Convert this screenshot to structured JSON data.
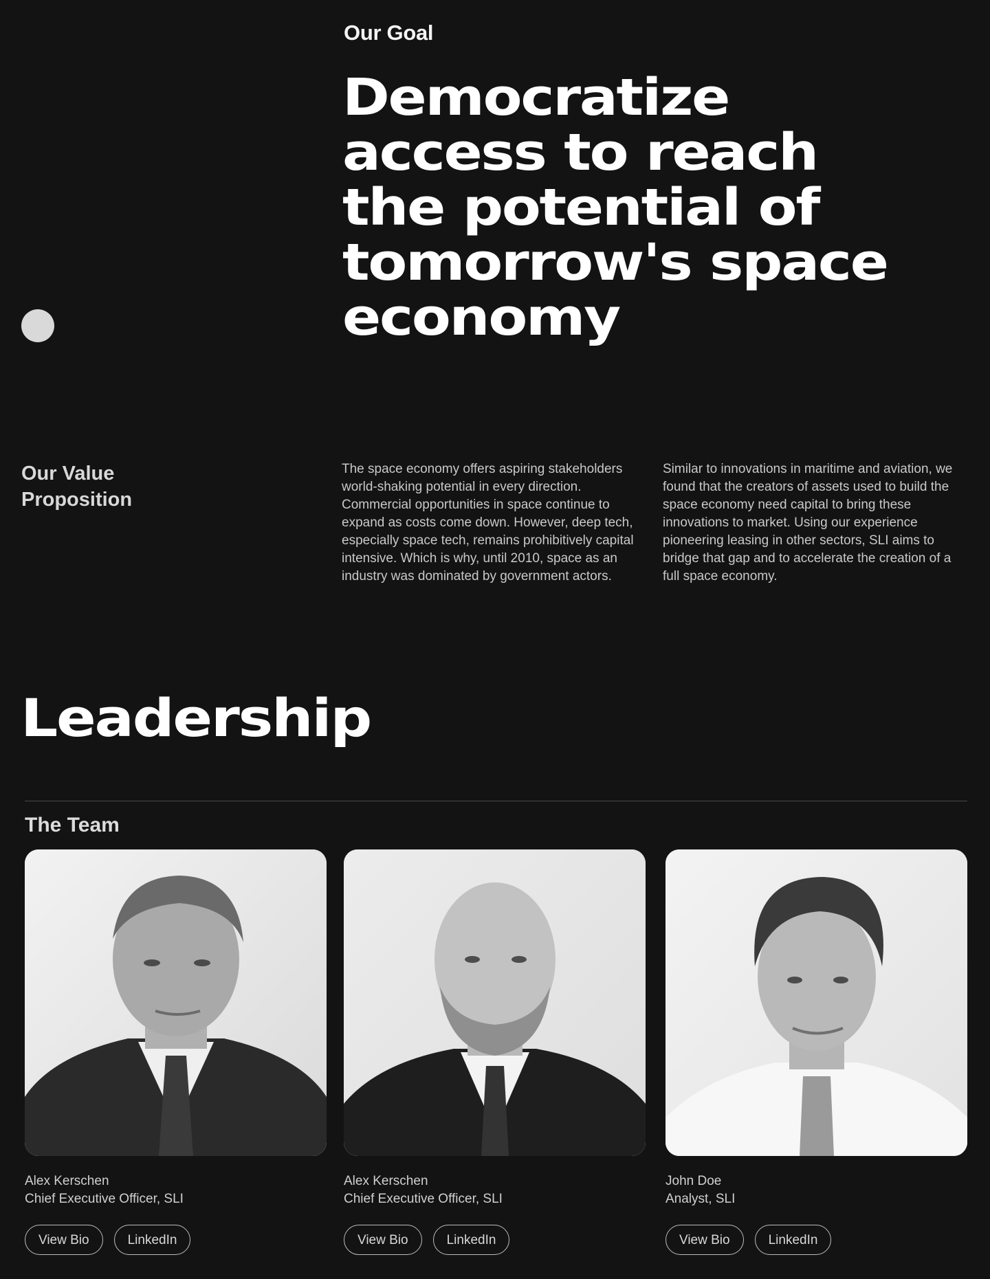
{
  "goal": {
    "eyebrow": "Our Goal",
    "headline_lines": [
      "Democratize",
      "access to reach",
      "the potential of",
      "tomorrow's space",
      "economy"
    ]
  },
  "value_proposition": {
    "heading_lines": [
      "Our Value",
      "Proposition"
    ],
    "paragraphs": [
      "The space economy offers aspiring stakeholders world-shaking potential in every direction. Commercial opportunities in space continue to expand as costs come down. However, deep tech, especially space tech, remains prohibitively capital intensive. Which is why, until 2010, space as an industry was dominated by government actors.",
      "Similar to innovations in maritime and aviation, we found that the creators of assets used to build the space economy need capital to bring these innovations to market. Using our experience pioneering leasing in other sectors, SLI aims to bridge that gap and to accelerate the creation of a full space economy."
    ]
  },
  "leadership": {
    "title": "Leadership",
    "team_heading": "The Team",
    "members": [
      {
        "name": "Alex Kerschen",
        "role": "Chief Executive Officer, SLI",
        "bio_label": "View Bio",
        "linkedin_label": "LinkedIn"
      },
      {
        "name": "Alex Kerschen",
        "role": "Chief Executive Officer, SLI",
        "bio_label": "View Bio",
        "linkedin_label": "LinkedIn"
      },
      {
        "name": "John Doe",
        "role": "Analyst, SLI",
        "bio_label": "View Bio",
        "linkedin_label": "LinkedIn"
      }
    ]
  },
  "colors": {
    "background": "#131313",
    "text_primary": "#ffffff",
    "text_secondary": "#c9c9c9",
    "divider": "#4a4a4a",
    "dot": "#d9d9d9"
  }
}
